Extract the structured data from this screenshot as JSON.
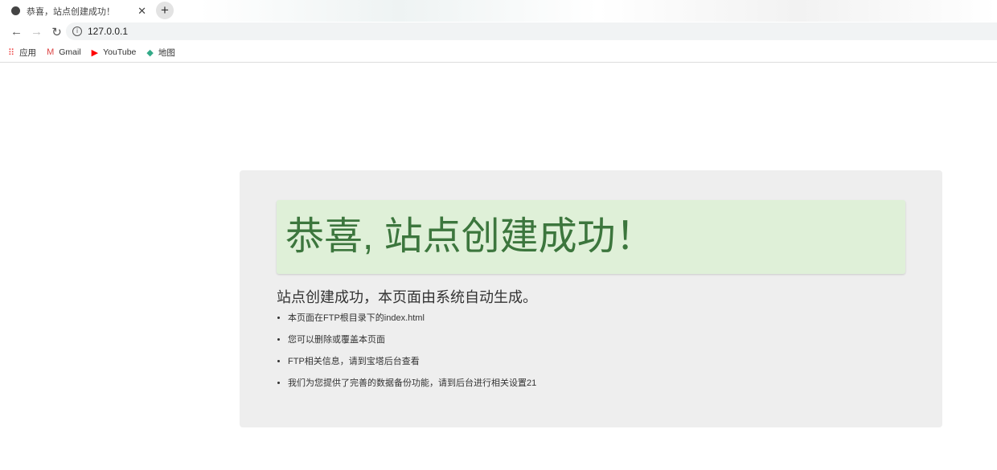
{
  "browser": {
    "tab_title": "恭喜，站点创建成功！",
    "url": "127.0.0.1",
    "bookmarks": [
      {
        "label": "应用",
        "icon": "apps-grid-icon"
      },
      {
        "label": "Gmail",
        "icon": "gmail-icon"
      },
      {
        "label": "YouTube",
        "icon": "youtube-icon"
      },
      {
        "label": "地图",
        "icon": "maps-icon"
      }
    ]
  },
  "page": {
    "heading": "恭喜, 站点创建成功！",
    "subtitle": "站点创建成功，本页面由系统自动生成。",
    "items": [
      "本页面在FTP根目录下的index.html",
      "您可以删除或覆盖本页面",
      "FTP相关信息，请到宝塔后台查看",
      "我们为您提供了完善的数据备份功能，请到后台进行相关设置21"
    ]
  },
  "colors": {
    "banner_bg": "#dff0d8",
    "banner_text": "#3c763d",
    "card_bg": "#eeeeee"
  }
}
